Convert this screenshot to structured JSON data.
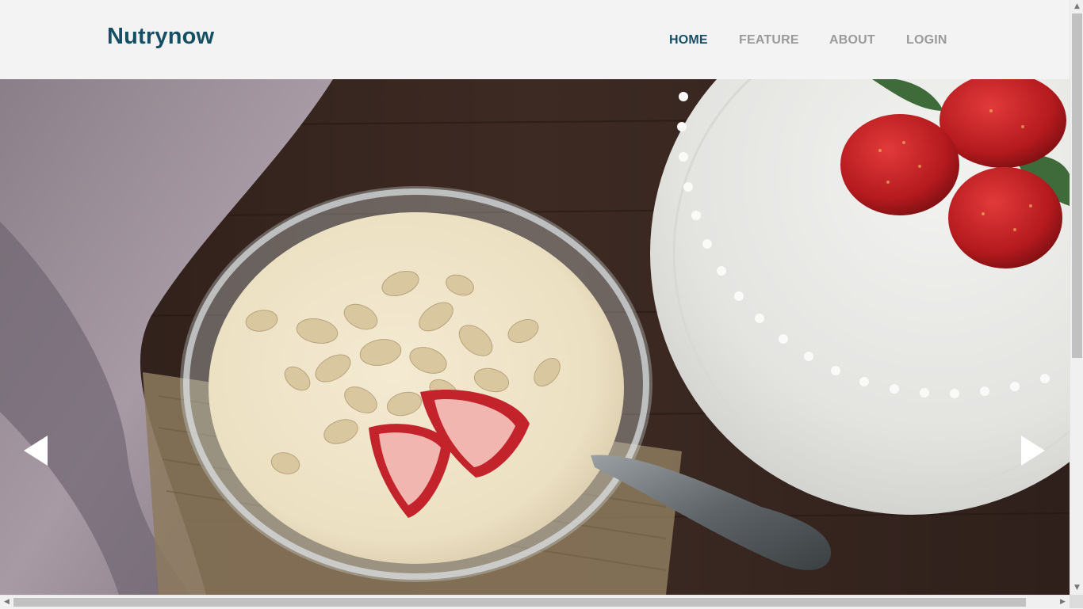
{
  "brand": {
    "name": "Nutrynow"
  },
  "nav": {
    "items": [
      {
        "label": "HOME",
        "active": true
      },
      {
        "label": "FEATURE",
        "active": false
      },
      {
        "label": "ABOUT",
        "active": false
      },
      {
        "label": "LOGIN",
        "active": false
      }
    ]
  },
  "hero": {
    "image": "yogurt-bowl-with-oats-and-strawberries",
    "prev_icon": "triangle-left-icon",
    "next_icon": "triangle-right-icon"
  },
  "colors": {
    "brand": "#164e63",
    "nav_inactive": "#9a9a9a",
    "header_bg": "#f3f3f3"
  }
}
